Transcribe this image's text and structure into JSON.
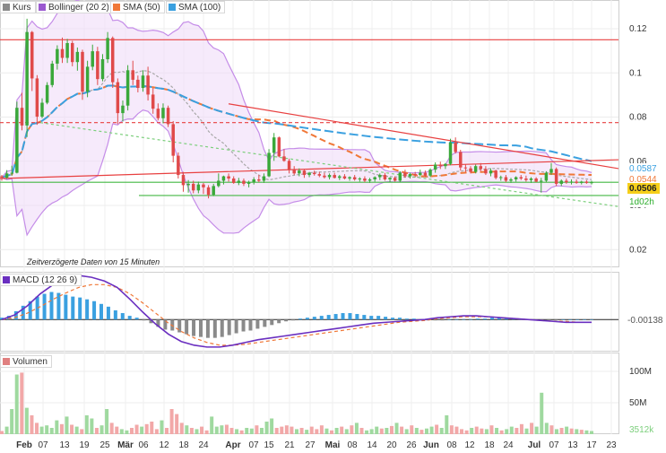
{
  "legend_price": [
    {
      "label": "Kurs",
      "color": "#8a8a8a"
    },
    {
      "label": "Bollinger (20 2)",
      "color": "#9b59d0"
    },
    {
      "label": "SMA (50)",
      "color": "#f07838"
    },
    {
      "label": "SMA (100)",
      "color": "#3aa0e0"
    }
  ],
  "legend_macd": {
    "label": "MACD (12 26 9)",
    "color": "#6a2fc0"
  },
  "legend_volume": {
    "label": "Volumen",
    "color": "#e08080"
  },
  "delay_note": "Zeitverzögerte Daten von 15 Minuten",
  "colors": {
    "up": "#3aa83a",
    "down": "#e04a4a",
    "bollinger": "#c58de8",
    "sma50": "#f07838",
    "sma100": "#3aa0e0",
    "trend_red": "#e84040",
    "support_green": "#44b844"
  },
  "chart_data": {
    "type": "candlestick",
    "price_axis": {
      "ticks": [
        0.12,
        0.1,
        0.08,
        0.06,
        0.04,
        0.02
      ],
      "tick_labels": [
        "0.12",
        "0.1",
        "0.08",
        "0.06",
        "0.04",
        "0.02"
      ],
      "ylim": [
        0.012,
        0.133
      ]
    },
    "x_axis": {
      "labels": [
        "Feb",
        "07",
        "13",
        "19",
        "25",
        "Mär",
        "06",
        "12",
        "18",
        "24",
        "Apr",
        "07",
        "15",
        "21",
        "27",
        "Mai",
        "08",
        "14",
        "20",
        "26",
        "Jun",
        "08",
        "12",
        "18",
        "24",
        "Jul",
        "07",
        "13",
        "17",
        "23"
      ],
      "bold": [
        "Feb",
        "Mär",
        "Apr",
        "Mai",
        "Jun",
        "Jul"
      ]
    },
    "price_tags": [
      {
        "value": "0.0587",
        "color": "#3aa0e0"
      },
      {
        "value": "0.0544",
        "color": "#f07838"
      },
      {
        "value": "0.0506",
        "color": "#f2c200"
      },
      {
        "value": "1d02h",
        "color": "#2fae2f"
      }
    ],
    "reference_lines": [
      {
        "value": 0.115,
        "style": "solid",
        "color": "#e84040"
      },
      {
        "value": 0.0775,
        "style": "dashed",
        "color": "#e84040"
      },
      {
        "value": 0.0505,
        "style": "solid",
        "color": "#44b844"
      },
      {
        "value": 0.0445,
        "style": "solid",
        "color": "#44b844"
      }
    ],
    "candles": [
      [
        0.0532,
        0.0538,
        0.0512,
        0.0526
      ],
      [
        0.0526,
        0.056,
        0.052,
        0.0545
      ],
      [
        0.0545,
        0.058,
        0.0535,
        0.0548
      ],
      [
        0.0548,
        0.087,
        0.0545,
        0.0842
      ],
      [
        0.0842,
        0.091,
        0.074,
        0.0762
      ],
      [
        0.0762,
        0.1245,
        0.071,
        0.1185
      ],
      [
        0.1185,
        0.119,
        0.0918,
        0.0975
      ],
      [
        0.0975,
        0.099,
        0.0765,
        0.0802
      ],
      [
        0.0802,
        0.0885,
        0.0795,
        0.0865
      ],
      [
        0.0865,
        0.0958,
        0.0858,
        0.0945
      ],
      [
        0.0945,
        0.1055,
        0.0935,
        0.1042
      ],
      [
        0.1042,
        0.1125,
        0.1015,
        0.1108
      ],
      [
        0.1108,
        0.116,
        0.1045,
        0.1068
      ],
      [
        0.1068,
        0.1154,
        0.1045,
        0.1135
      ],
      [
        0.1135,
        0.1145,
        0.103,
        0.1049
      ],
      [
        0.1049,
        0.1115,
        0.101,
        0.1095
      ],
      [
        0.1095,
        0.1105,
        0.0878,
        0.0915
      ],
      [
        0.0915,
        0.1055,
        0.089,
        0.1028
      ],
      [
        0.1028,
        0.1128,
        0.1012,
        0.1098
      ],
      [
        0.1098,
        0.1118,
        0.0945,
        0.0972
      ],
      [
        0.0972,
        0.1085,
        0.0962,
        0.1062
      ],
      [
        0.1062,
        0.1185,
        0.1045,
        0.1158
      ],
      [
        0.1158,
        0.1165,
        0.0932,
        0.0958
      ],
      [
        0.0958,
        0.0975,
        0.0768,
        0.0818
      ],
      [
        0.0818,
        0.0875,
        0.078,
        0.0852
      ],
      [
        0.0852,
        0.1035,
        0.083,
        0.1012
      ],
      [
        0.1012,
        0.1055,
        0.0945,
        0.0969
      ],
      [
        0.0969,
        0.0988,
        0.0912,
        0.0932
      ],
      [
        0.0932,
        0.1012,
        0.0915,
        0.0988
      ],
      [
        0.0988,
        0.1028,
        0.0875,
        0.0902
      ],
      [
        0.0902,
        0.0932,
        0.0815,
        0.0838
      ],
      [
        0.0838,
        0.0862,
        0.0785,
        0.0795
      ],
      [
        0.0795,
        0.0862,
        0.0772,
        0.0842
      ],
      [
        0.0842,
        0.0852,
        0.0755,
        0.0768
      ],
      [
        0.0768,
        0.0782,
        0.0595,
        0.0625
      ],
      [
        0.0625,
        0.064,
        0.0522,
        0.0538
      ],
      [
        0.0538,
        0.0552,
        0.0462,
        0.0492
      ],
      [
        0.0492,
        0.0515,
        0.0458,
        0.0498
      ],
      [
        0.0498,
        0.0512,
        0.0455,
        0.0468
      ],
      [
        0.0468,
        0.0508,
        0.0455,
        0.0495
      ],
      [
        0.0495,
        0.0502,
        0.0452,
        0.0482
      ],
      [
        0.0482,
        0.0492,
        0.0432,
        0.0448
      ],
      [
        0.0448,
        0.0498,
        0.0442,
        0.0488
      ],
      [
        0.0488,
        0.0545,
        0.0482,
        0.0512
      ],
      [
        0.0512,
        0.0535,
        0.0495,
        0.0532
      ],
      [
        0.0532,
        0.0545,
        0.0508,
        0.0522
      ],
      [
        0.0522,
        0.0532,
        0.0498,
        0.0502
      ],
      [
        0.0502,
        0.0525,
        0.0492,
        0.0512
      ],
      [
        0.0512,
        0.0522,
        0.0488,
        0.0498
      ],
      [
        0.0498,
        0.0512,
        0.0482,
        0.0505
      ],
      [
        0.0505,
        0.0528,
        0.0495,
        0.0518
      ],
      [
        0.0518,
        0.0538,
        0.0505,
        0.0512
      ],
      [
        0.0512,
        0.0545,
        0.0502,
        0.0532
      ],
      [
        0.0532,
        0.0655,
        0.0528,
        0.0638
      ],
      [
        0.0638,
        0.0728,
        0.0602,
        0.0708
      ],
      [
        0.0708,
        0.0712,
        0.0618,
        0.0622
      ],
      [
        0.0622,
        0.0655,
        0.0598,
        0.0602
      ],
      [
        0.0602,
        0.0612,
        0.0545,
        0.0562
      ],
      [
        0.0562,
        0.0578,
        0.0538,
        0.0545
      ],
      [
        0.0545,
        0.0568,
        0.0532,
        0.0558
      ],
      [
        0.0558,
        0.0562,
        0.0525,
        0.0538
      ],
      [
        0.0538,
        0.0552,
        0.0528,
        0.0548
      ],
      [
        0.0548,
        0.0558,
        0.0535,
        0.0542
      ],
      [
        0.0542,
        0.0552,
        0.0528,
        0.0535
      ],
      [
        0.0535,
        0.0548,
        0.0522,
        0.0528
      ],
      [
        0.0528,
        0.0545,
        0.0518,
        0.0538
      ],
      [
        0.0538,
        0.0548,
        0.0522,
        0.0525
      ],
      [
        0.0525,
        0.0538,
        0.0515,
        0.0532
      ],
      [
        0.0532,
        0.0542,
        0.0518,
        0.0522
      ],
      [
        0.0522,
        0.0532,
        0.0512,
        0.0528
      ],
      [
        0.0528,
        0.0538,
        0.0512,
        0.0518
      ],
      [
        0.0518,
        0.0528,
        0.0508,
        0.0522
      ],
      [
        0.0522,
        0.0532,
        0.0505,
        0.0512
      ],
      [
        0.0512,
        0.0525,
        0.0502,
        0.0518
      ],
      [
        0.0518,
        0.0532,
        0.0508,
        0.0528
      ],
      [
        0.0528,
        0.0545,
        0.0515,
        0.0538
      ],
      [
        0.0538,
        0.0548,
        0.0512,
        0.0518
      ],
      [
        0.0518,
        0.0528,
        0.0505,
        0.0525
      ],
      [
        0.0525,
        0.0532,
        0.0508,
        0.0512
      ],
      [
        0.0512,
        0.0555,
        0.0505,
        0.0548
      ],
      [
        0.0548,
        0.0562,
        0.0525,
        0.0532
      ],
      [
        0.0532,
        0.0548,
        0.0522,
        0.0542
      ],
      [
        0.0542,
        0.0552,
        0.0528,
        0.0538
      ],
      [
        0.0538,
        0.0562,
        0.0532,
        0.0548
      ],
      [
        0.0548,
        0.0558,
        0.0528,
        0.0535
      ],
      [
        0.0535,
        0.0568,
        0.0528,
        0.0562
      ],
      [
        0.0562,
        0.0595,
        0.0548,
        0.0585
      ],
      [
        0.0585,
        0.0598,
        0.0565,
        0.0578
      ],
      [
        0.0578,
        0.0592,
        0.0565,
        0.0588
      ],
      [
        0.0588,
        0.0702,
        0.0582,
        0.0685
      ],
      [
        0.0685,
        0.0708,
        0.0635,
        0.0642
      ],
      [
        0.0642,
        0.0652,
        0.0558,
        0.0572
      ],
      [
        0.0572,
        0.0585,
        0.0552,
        0.0568
      ],
      [
        0.0568,
        0.0578,
        0.0545,
        0.0552
      ],
      [
        0.0552,
        0.0585,
        0.0545,
        0.0578
      ],
      [
        0.0578,
        0.0592,
        0.0555,
        0.0565
      ],
      [
        0.0565,
        0.0578,
        0.0538,
        0.0545
      ],
      [
        0.0545,
        0.0568,
        0.0532,
        0.0558
      ],
      [
        0.0558,
        0.0562,
        0.0518,
        0.0525
      ],
      [
        0.0525,
        0.0535,
        0.0512,
        0.0528
      ],
      [
        0.0528,
        0.0538,
        0.0505,
        0.0512
      ],
      [
        0.0512,
        0.0525,
        0.0502,
        0.0518
      ],
      [
        0.0518,
        0.0532,
        0.0508,
        0.0528
      ],
      [
        0.0528,
        0.0538,
        0.0515,
        0.0522
      ],
      [
        0.0522,
        0.0535,
        0.0508,
        0.0515
      ],
      [
        0.0515,
        0.0528,
        0.0502,
        0.0522
      ],
      [
        0.0522,
        0.0528,
        0.0505,
        0.0508
      ],
      [
        0.0508,
        0.0525,
        0.0458,
        0.0512
      ],
      [
        0.0512,
        0.0555,
        0.0505,
        0.0548
      ],
      [
        0.0548,
        0.0592,
        0.0538,
        0.0565
      ],
      [
        0.0565,
        0.0572,
        0.0488,
        0.0498
      ],
      [
        0.0498,
        0.0518,
        0.0488,
        0.0512
      ],
      [
        0.0512,
        0.0522,
        0.0498,
        0.0505
      ],
      [
        0.0505,
        0.0518,
        0.0495,
        0.0508
      ],
      [
        0.0508,
        0.0518,
        0.0498,
        0.0502
      ],
      [
        0.0502,
        0.0512,
        0.0495,
        0.0508
      ],
      [
        0.0508,
        0.0515,
        0.0498,
        0.0502
      ],
      [
        0.0502,
        0.0512,
        0.0495,
        0.0505
      ]
    ],
    "macd": {
      "ylim": [
        -0.0035,
        0.0052
      ],
      "tag": "-0.00138",
      "histogram": [
        0.0002,
        0.0004,
        0.0009,
        0.0015,
        0.002,
        0.0025,
        0.0028,
        0.003,
        0.0029,
        0.0027,
        0.0025,
        0.0024,
        0.0022,
        0.002,
        0.0017,
        0.0014,
        0.001,
        0.0007,
        0.0004,
        0.0002,
        -0.0001,
        -0.0004,
        -0.0008,
        -0.0011,
        -0.0012,
        -0.0014,
        -0.0016,
        -0.0018,
        -0.0019,
        -0.002,
        -0.002,
        -0.0019,
        -0.0017,
        -0.0015,
        -0.0013,
        -0.0012,
        -0.001,
        -0.0008,
        -0.0006,
        -0.0004,
        -0.0002,
        -0.0001,
        0.0001,
        0.0002,
        0.0003,
        0.0004,
        0.0005,
        0.0006,
        0.0007,
        0.0007,
        0.0006,
        0.0005,
        0.0004,
        0.0004,
        0.0003,
        0.0002,
        0.0002,
        0.0001,
        0.0001,
        0.0,
        -0.0001,
        -0.0001,
        -0.0001,
        0.0,
        0.0,
        0.0,
        0.0,
        0.0001,
        0.0001,
        0.0002,
        0.0002,
        0.0002,
        0.0001,
        0.0001,
        0.0,
        0.0,
        -0.0001,
        -0.0001,
        -0.0001,
        0.0,
        0.0,
        0.0,
        0.0,
        0.0
      ],
      "macd_line": [
        0.0,
        0.0005,
        0.0015,
        0.0028,
        0.0038,
        0.0045,
        0.0048,
        0.0046,
        0.0042,
        0.0035,
        0.0022,
        0.0008,
        -0.0005,
        -0.0016,
        -0.0024,
        -0.0028,
        -0.003,
        -0.003,
        -0.0028,
        -0.0025,
        -0.0022,
        -0.002,
        -0.0018,
        -0.0016,
        -0.0014,
        -0.0012,
        -0.001,
        -0.0008,
        -0.0006,
        -0.0004,
        -0.0003,
        -0.0002,
        -0.0001,
        0.0,
        0.0002,
        0.0003,
        0.0004,
        0.0004,
        0.0003,
        0.0002,
        0.0001,
        0.0,
        -0.0001,
        -0.0002,
        -0.0003,
        -0.0003,
        -0.0003
      ],
      "signal_line": [
        0.0,
        0.0002,
        0.0007,
        0.0014,
        0.0022,
        0.0029,
        0.0035,
        0.0038,
        0.0038,
        0.0035,
        0.0028,
        0.0018,
        0.0007,
        -0.0004,
        -0.0013,
        -0.002,
        -0.0025,
        -0.0028,
        -0.0028,
        -0.0027,
        -0.0025,
        -0.0023,
        -0.0021,
        -0.0019,
        -0.0017,
        -0.0015,
        -0.0013,
        -0.0011,
        -0.0009,
        -0.0007,
        -0.0005,
        -0.0003,
        -0.0002,
        -0.0001,
        0.0001,
        0.0002,
        0.0003,
        0.0003,
        0.0003,
        0.0002,
        0.0001,
        0.0,
        -0.0001,
        -0.0002,
        -0.0002,
        -0.0003,
        -0.0003
      ]
    },
    "volume": {
      "ticks": [
        "100M",
        "50M"
      ],
      "tag": "3512k",
      "ylim_millions": [
        0,
        130
      ],
      "values_millions": [
        5,
        12,
        40,
        95,
        98,
        42,
        30,
        18,
        12,
        14,
        10,
        22,
        16,
        28,
        15,
        12,
        8,
        30,
        25,
        10,
        14,
        40,
        18,
        12,
        8,
        6,
        10,
        15,
        12,
        16,
        20,
        8,
        22,
        10,
        40,
        32,
        18,
        14,
        10,
        8,
        12,
        6,
        28,
        12,
        14,
        15,
        10,
        8,
        6,
        10,
        9,
        14,
        10,
        20,
        25,
        10,
        12,
        14,
        12,
        8,
        10,
        7,
        12,
        8,
        14,
        9,
        6,
        10,
        12,
        8,
        14,
        18,
        10,
        6,
        8,
        12,
        9,
        10,
        13,
        18,
        12,
        8,
        14,
        10,
        7,
        9,
        12,
        15,
        10,
        30,
        14,
        12,
        8,
        6,
        10,
        12,
        9,
        8,
        14,
        10,
        6,
        8,
        12,
        10,
        16,
        9,
        18,
        12,
        66,
        18,
        14,
        8,
        10,
        12,
        9,
        8,
        7,
        6,
        5
      ]
    }
  }
}
